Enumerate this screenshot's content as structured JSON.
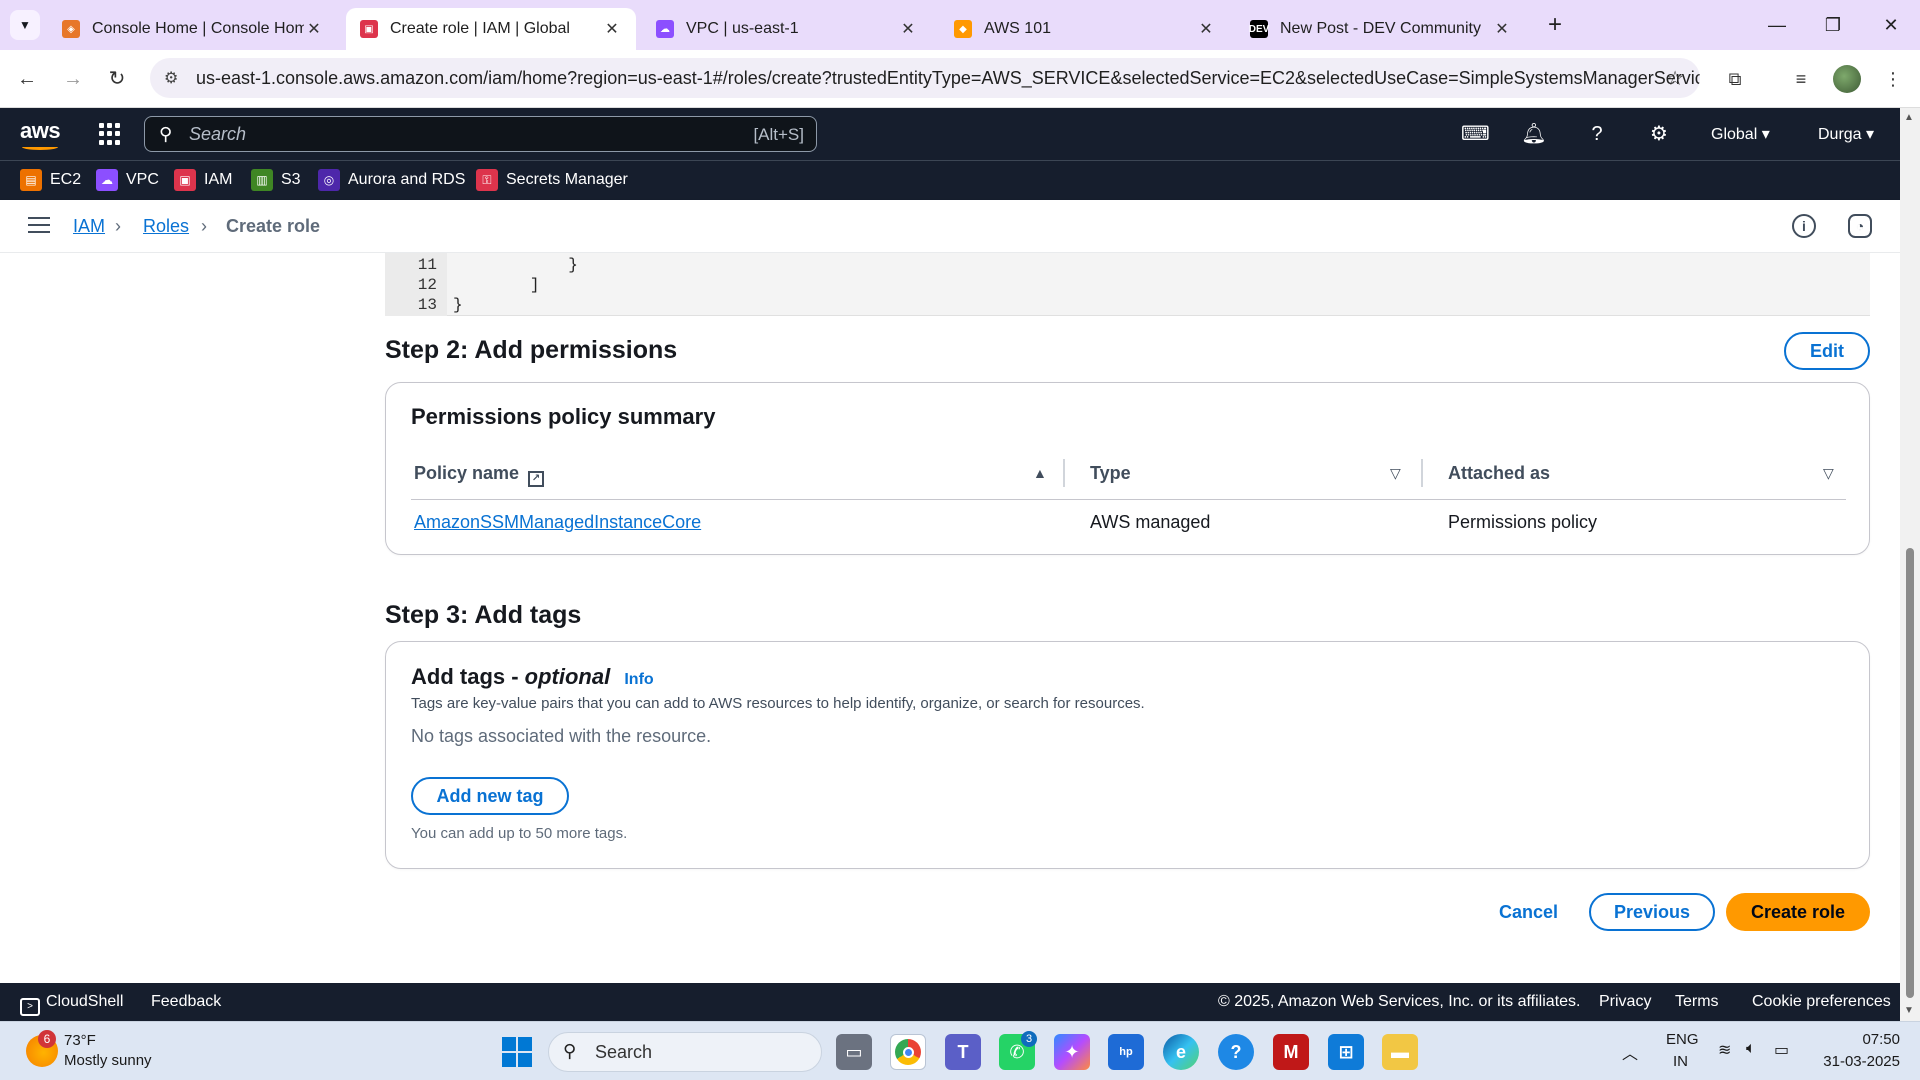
{
  "browser": {
    "tabs": [
      {
        "title": "Console Home | Console Home",
        "icon": "aws-console-icon",
        "color": "#e7772a"
      },
      {
        "title": "Create role | IAM | Global",
        "icon": "iam-icon",
        "color": "#dd344c"
      },
      {
        "title": "VPC | us-east-1",
        "icon": "vpc-icon",
        "color": "#8c4fff"
      },
      {
        "title": "AWS 101",
        "icon": "aws-cube-icon",
        "color": "#ff9900"
      },
      {
        "title": "New Post - DEV Community",
        "icon": "dev-icon",
        "color": "#000000"
      }
    ],
    "active_tab_index": 1,
    "url": "us-east-1.console.aws.amazon.com/iam/home?region=us-east-1#/roles/create?trustedEntityType=AWS_SERVICE&selectedService=EC2&selectedUseCase=SimpleSystemsManagerService..."
  },
  "awsnav": {
    "search_placeholder": "Search",
    "search_shortcut": "[Alt+S]",
    "region": "Global",
    "user": "Durga"
  },
  "favorites": [
    {
      "label": "EC2",
      "color": "#ed7100"
    },
    {
      "label": "VPC",
      "color": "#8c4fff"
    },
    {
      "label": "IAM",
      "color": "#dd344c"
    },
    {
      "label": "S3",
      "color": "#3f8624"
    },
    {
      "label": "Aurora and RDS",
      "color": "#4d27aa"
    },
    {
      "label": "Secrets Manager",
      "color": "#dd344c"
    }
  ],
  "breadcrumb": {
    "items": [
      "IAM",
      "Roles",
      "Create role"
    ]
  },
  "code": {
    "lines": [
      {
        "num": "11",
        "text": "            }"
      },
      {
        "num": "12",
        "text": "        ]"
      },
      {
        "num": "13",
        "text": "}"
      }
    ]
  },
  "step2": {
    "title": "Step 2: Add permissions",
    "edit_label": "Edit",
    "panel_title": "Permissions policy summary",
    "columns": [
      "Policy name",
      "Type",
      "Attached as"
    ],
    "rows": [
      {
        "policy_name": "AmazonSSMManagedInstanceCore",
        "type": "AWS managed",
        "attached_as": "Permissions policy"
      }
    ]
  },
  "step3": {
    "title": "Step 3: Add tags",
    "panel_title": "Add tags - ",
    "panel_title_optional": "optional",
    "info_label": "Info",
    "description": "Tags are key-value pairs that you can add to AWS resources to help identify, organize, or search for resources.",
    "empty_text": "No tags associated with the resource.",
    "add_tag_label": "Add new tag",
    "limit_text": "You can add up to 50 more tags."
  },
  "actions": {
    "cancel": "Cancel",
    "previous": "Previous",
    "create": "Create role"
  },
  "footer": {
    "cloudshell": "CloudShell",
    "feedback": "Feedback",
    "copyright": "© 2025, Amazon Web Services, Inc. or its affiliates.",
    "privacy": "Privacy",
    "terms": "Terms",
    "cookies": "Cookie preferences"
  },
  "taskbar": {
    "weather_temp": "73°F",
    "weather_desc": "Mostly sunny",
    "weather_badge": "6",
    "search_label": "Search",
    "teams_badge": "3",
    "lang_1": "ENG",
    "lang_2": "IN",
    "time": "07:50",
    "date": "31-03-2025"
  }
}
